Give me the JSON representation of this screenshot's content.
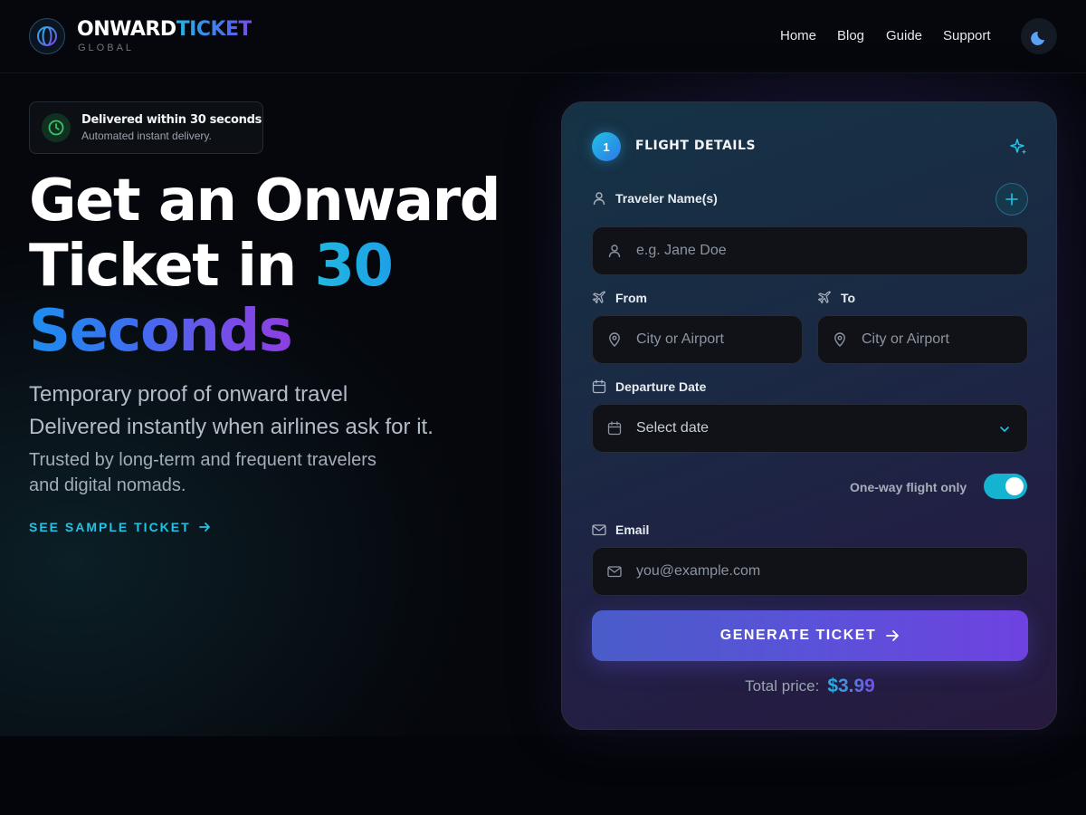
{
  "brand": {
    "name_part1": "ONWARD",
    "name_part2": "TICKET",
    "sub": "GLOBAL"
  },
  "nav": {
    "items": [
      "Home",
      "Blog",
      "Guide",
      "Support"
    ]
  },
  "theme_toggle": {
    "icon": "moon-icon"
  },
  "badge": {
    "icon": "clock-icon",
    "title": "Delivered within 30 seconds",
    "subtitle": "Automated instant delivery."
  },
  "hero": {
    "title_line1": "Get an Onward",
    "title_line2_a": "Ticket in ",
    "title_line2_b": "30",
    "title_line3": "Seconds",
    "subtitle_line1": "Temporary proof of onward travel",
    "subtitle_line2": "Delivered instantly when airlines ask for it.",
    "trust_line1": "Trusted by long-term and frequent travelers",
    "trust_line2": "and digital nomads.",
    "sample_link": "SEE SAMPLE TICKET"
  },
  "form": {
    "step_number": "1",
    "step_title": "FLIGHT DETAILS",
    "traveler_label": "Traveler Name(s)",
    "traveler_placeholder": "e.g. Jane Doe",
    "from_label": "From",
    "from_placeholder": "City or Airport",
    "to_label": "To",
    "to_placeholder": "City or Airport",
    "date_label": "Departure Date",
    "date_value": "Select date",
    "oneway_label": "One-way flight only",
    "oneway_on": true,
    "email_label": "Email",
    "email_placeholder": "you@example.com",
    "submit_label": "GENERATE TICKET",
    "price_label": "Total price:",
    "price_value": "$3.99"
  },
  "colors": {
    "accent_cyan": "#22c3e6",
    "accent_purple": "#7a4be6",
    "background": "#05070c"
  }
}
